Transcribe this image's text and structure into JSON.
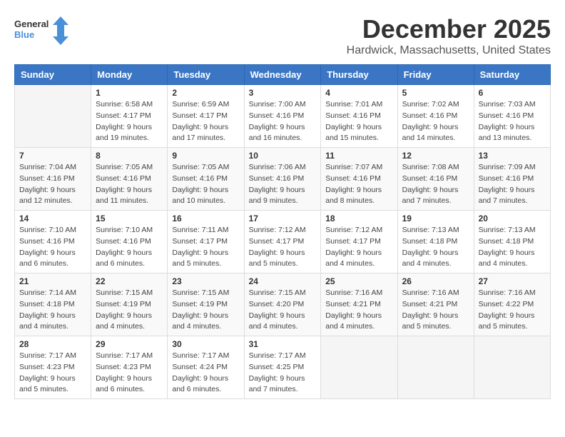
{
  "header": {
    "logo_general": "General",
    "logo_blue": "Blue",
    "month_title": "December 2025",
    "location": "Hardwick, Massachusetts, United States"
  },
  "days_of_week": [
    "Sunday",
    "Monday",
    "Tuesday",
    "Wednesday",
    "Thursday",
    "Friday",
    "Saturday"
  ],
  "weeks": [
    [
      {
        "day": "",
        "sunrise": "",
        "sunset": "",
        "daylight": ""
      },
      {
        "day": "1",
        "sunrise": "Sunrise: 6:58 AM",
        "sunset": "Sunset: 4:17 PM",
        "daylight": "Daylight: 9 hours and 19 minutes."
      },
      {
        "day": "2",
        "sunrise": "Sunrise: 6:59 AM",
        "sunset": "Sunset: 4:17 PM",
        "daylight": "Daylight: 9 hours and 17 minutes."
      },
      {
        "day": "3",
        "sunrise": "Sunrise: 7:00 AM",
        "sunset": "Sunset: 4:16 PM",
        "daylight": "Daylight: 9 hours and 16 minutes."
      },
      {
        "day": "4",
        "sunrise": "Sunrise: 7:01 AM",
        "sunset": "Sunset: 4:16 PM",
        "daylight": "Daylight: 9 hours and 15 minutes."
      },
      {
        "day": "5",
        "sunrise": "Sunrise: 7:02 AM",
        "sunset": "Sunset: 4:16 PM",
        "daylight": "Daylight: 9 hours and 14 minutes."
      },
      {
        "day": "6",
        "sunrise": "Sunrise: 7:03 AM",
        "sunset": "Sunset: 4:16 PM",
        "daylight": "Daylight: 9 hours and 13 minutes."
      }
    ],
    [
      {
        "day": "7",
        "sunrise": "Sunrise: 7:04 AM",
        "sunset": "Sunset: 4:16 PM",
        "daylight": "Daylight: 9 hours and 12 minutes."
      },
      {
        "day": "8",
        "sunrise": "Sunrise: 7:05 AM",
        "sunset": "Sunset: 4:16 PM",
        "daylight": "Daylight: 9 hours and 11 minutes."
      },
      {
        "day": "9",
        "sunrise": "Sunrise: 7:05 AM",
        "sunset": "Sunset: 4:16 PM",
        "daylight": "Daylight: 9 hours and 10 minutes."
      },
      {
        "day": "10",
        "sunrise": "Sunrise: 7:06 AM",
        "sunset": "Sunset: 4:16 PM",
        "daylight": "Daylight: 9 hours and 9 minutes."
      },
      {
        "day": "11",
        "sunrise": "Sunrise: 7:07 AM",
        "sunset": "Sunset: 4:16 PM",
        "daylight": "Daylight: 9 hours and 8 minutes."
      },
      {
        "day": "12",
        "sunrise": "Sunrise: 7:08 AM",
        "sunset": "Sunset: 4:16 PM",
        "daylight": "Daylight: 9 hours and 7 minutes."
      },
      {
        "day": "13",
        "sunrise": "Sunrise: 7:09 AM",
        "sunset": "Sunset: 4:16 PM",
        "daylight": "Daylight: 9 hours and 7 minutes."
      }
    ],
    [
      {
        "day": "14",
        "sunrise": "Sunrise: 7:10 AM",
        "sunset": "Sunset: 4:16 PM",
        "daylight": "Daylight: 9 hours and 6 minutes."
      },
      {
        "day": "15",
        "sunrise": "Sunrise: 7:10 AM",
        "sunset": "Sunset: 4:16 PM",
        "daylight": "Daylight: 9 hours and 6 minutes."
      },
      {
        "day": "16",
        "sunrise": "Sunrise: 7:11 AM",
        "sunset": "Sunset: 4:17 PM",
        "daylight": "Daylight: 9 hours and 5 minutes."
      },
      {
        "day": "17",
        "sunrise": "Sunrise: 7:12 AM",
        "sunset": "Sunset: 4:17 PM",
        "daylight": "Daylight: 9 hours and 5 minutes."
      },
      {
        "day": "18",
        "sunrise": "Sunrise: 7:12 AM",
        "sunset": "Sunset: 4:17 PM",
        "daylight": "Daylight: 9 hours and 4 minutes."
      },
      {
        "day": "19",
        "sunrise": "Sunrise: 7:13 AM",
        "sunset": "Sunset: 4:18 PM",
        "daylight": "Daylight: 9 hours and 4 minutes."
      },
      {
        "day": "20",
        "sunrise": "Sunrise: 7:13 AM",
        "sunset": "Sunset: 4:18 PM",
        "daylight": "Daylight: 9 hours and 4 minutes."
      }
    ],
    [
      {
        "day": "21",
        "sunrise": "Sunrise: 7:14 AM",
        "sunset": "Sunset: 4:18 PM",
        "daylight": "Daylight: 9 hours and 4 minutes."
      },
      {
        "day": "22",
        "sunrise": "Sunrise: 7:15 AM",
        "sunset": "Sunset: 4:19 PM",
        "daylight": "Daylight: 9 hours and 4 minutes."
      },
      {
        "day": "23",
        "sunrise": "Sunrise: 7:15 AM",
        "sunset": "Sunset: 4:19 PM",
        "daylight": "Daylight: 9 hours and 4 minutes."
      },
      {
        "day": "24",
        "sunrise": "Sunrise: 7:15 AM",
        "sunset": "Sunset: 4:20 PM",
        "daylight": "Daylight: 9 hours and 4 minutes."
      },
      {
        "day": "25",
        "sunrise": "Sunrise: 7:16 AM",
        "sunset": "Sunset: 4:21 PM",
        "daylight": "Daylight: 9 hours and 4 minutes."
      },
      {
        "day": "26",
        "sunrise": "Sunrise: 7:16 AM",
        "sunset": "Sunset: 4:21 PM",
        "daylight": "Daylight: 9 hours and 5 minutes."
      },
      {
        "day": "27",
        "sunrise": "Sunrise: 7:16 AM",
        "sunset": "Sunset: 4:22 PM",
        "daylight": "Daylight: 9 hours and 5 minutes."
      }
    ],
    [
      {
        "day": "28",
        "sunrise": "Sunrise: 7:17 AM",
        "sunset": "Sunset: 4:23 PM",
        "daylight": "Daylight: 9 hours and 5 minutes."
      },
      {
        "day": "29",
        "sunrise": "Sunrise: 7:17 AM",
        "sunset": "Sunset: 4:23 PM",
        "daylight": "Daylight: 9 hours and 6 minutes."
      },
      {
        "day": "30",
        "sunrise": "Sunrise: 7:17 AM",
        "sunset": "Sunset: 4:24 PM",
        "daylight": "Daylight: 9 hours and 6 minutes."
      },
      {
        "day": "31",
        "sunrise": "Sunrise: 7:17 AM",
        "sunset": "Sunset: 4:25 PM",
        "daylight": "Daylight: 9 hours and 7 minutes."
      },
      {
        "day": "",
        "sunrise": "",
        "sunset": "",
        "daylight": ""
      },
      {
        "day": "",
        "sunrise": "",
        "sunset": "",
        "daylight": ""
      },
      {
        "day": "",
        "sunrise": "",
        "sunset": "",
        "daylight": ""
      }
    ]
  ]
}
